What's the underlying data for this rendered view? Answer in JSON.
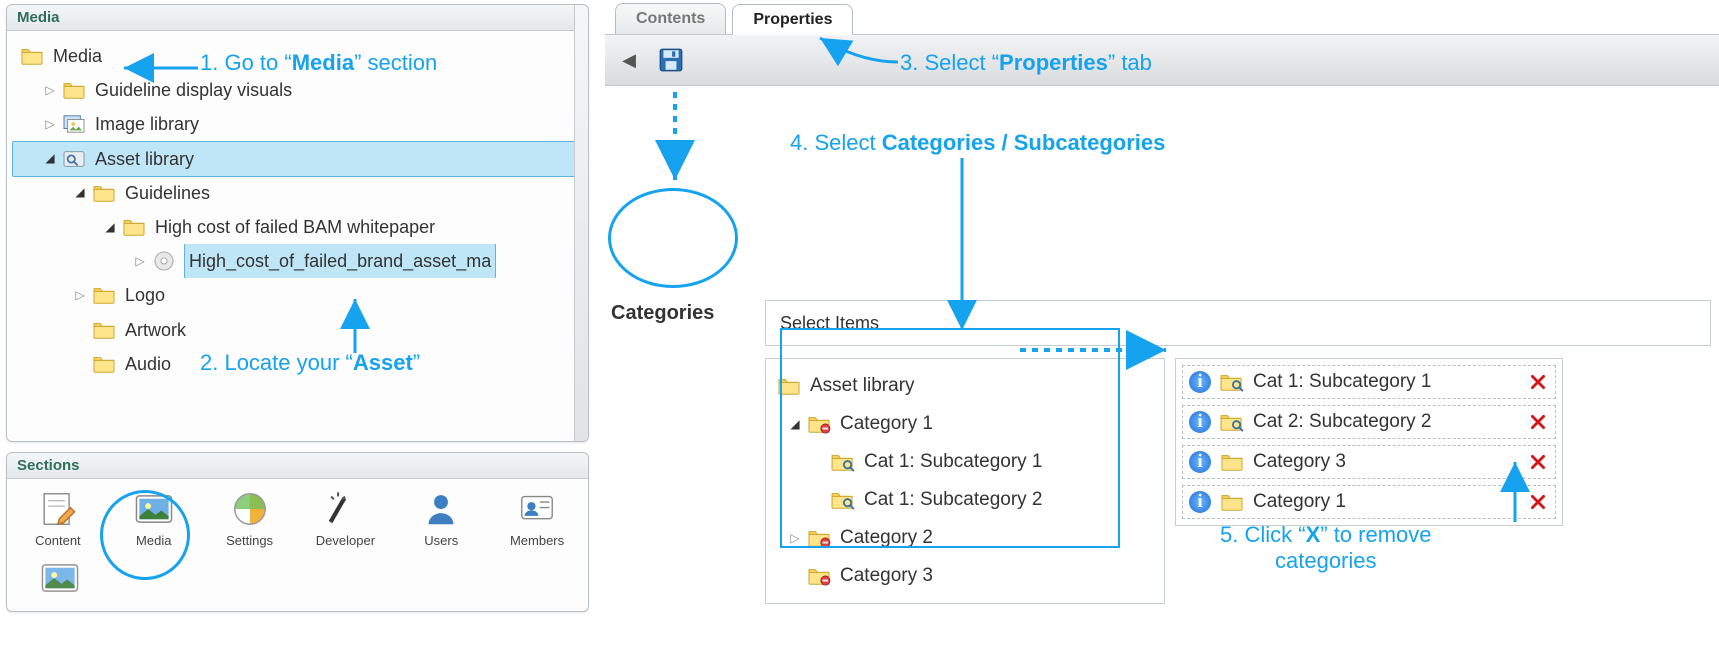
{
  "left": {
    "media_panel_title": "Media",
    "sections_panel_title": "Sections",
    "tree": {
      "root": "Media",
      "nodes": [
        {
          "label": "Guideline display visuals"
        },
        {
          "label": "Image library"
        },
        {
          "label": "Asset library"
        },
        {
          "label": "Guidelines"
        },
        {
          "label": "High cost of failed BAM whitepaper"
        },
        {
          "label": "High_cost_of_failed_brand_asset_ma"
        },
        {
          "label": "Logo"
        },
        {
          "label": "Artwork"
        },
        {
          "label": "Audio"
        }
      ]
    },
    "sections": [
      {
        "label": "Content"
      },
      {
        "label": "Media"
      },
      {
        "label": "Settings"
      },
      {
        "label": "Developer"
      },
      {
        "label": "Users"
      },
      {
        "label": "Members"
      }
    ]
  },
  "right": {
    "tabs": {
      "contents": "Contents",
      "properties": "Properties"
    },
    "categories_label": "Categories",
    "select_items_label": "Select Items",
    "tree": {
      "root": "Asset library",
      "items": [
        {
          "label": "Category 1"
        },
        {
          "label": "Cat 1: Subcategory 1"
        },
        {
          "label": "Cat 1: Subcategory 2"
        },
        {
          "label": "Category 2"
        },
        {
          "label": "Category 3"
        }
      ]
    },
    "selected": [
      {
        "label": "Cat 1: Subcategory 1"
      },
      {
        "label": "Cat 2: Subcategory 2"
      },
      {
        "label": "Category 3"
      },
      {
        "label": "Category 1"
      }
    ]
  },
  "annotations": {
    "step1_a": "1. Go to “",
    "step1_b": "Media",
    "step1_c": "” section",
    "step2_a": "2. Locate your “",
    "step2_b": "Asset",
    "step2_c": "”",
    "step3_a": "3. Select “",
    "step3_b": "Properties",
    "step3_c": "” tab",
    "step4_a": "4. Select ",
    "step4_b": "Categories / Subcategories",
    "step5_a": "5. Click “",
    "step5_b": "X",
    "step5_c": "” to remove",
    "step5_d": "categories"
  }
}
